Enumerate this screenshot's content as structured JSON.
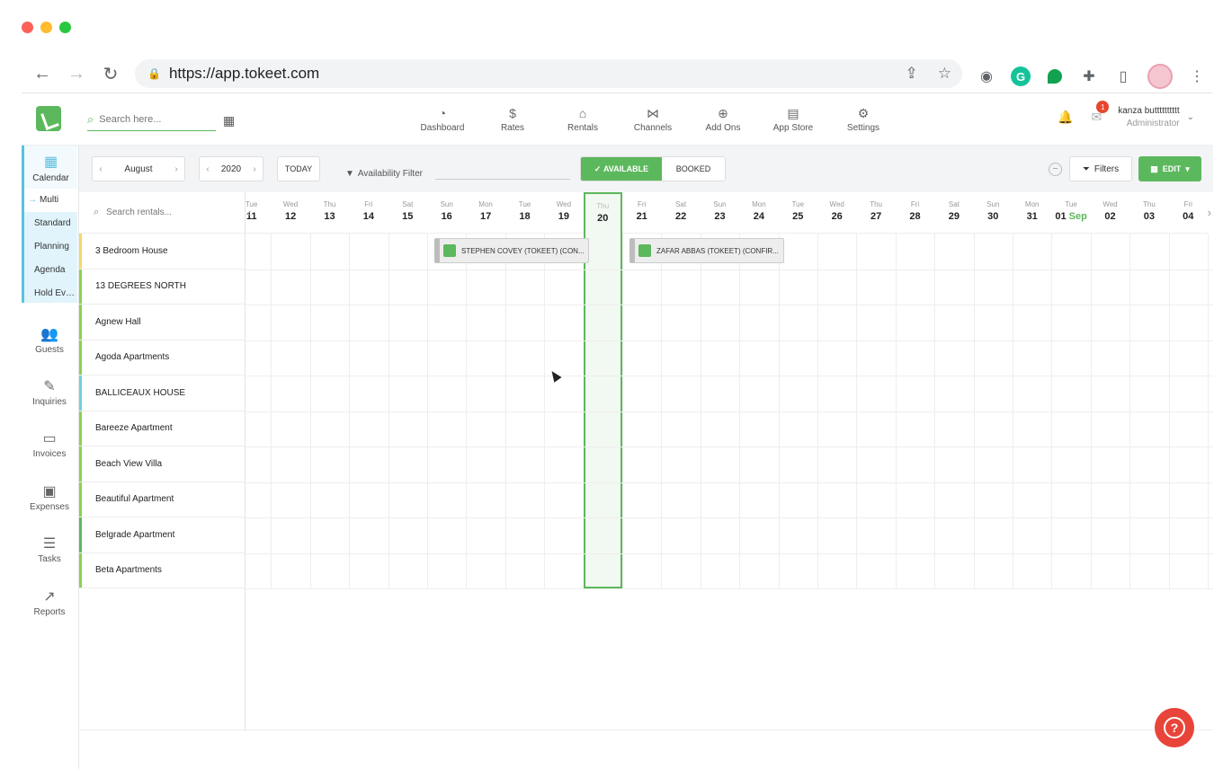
{
  "browser": {
    "url": "https://app.tokeet.com",
    "back_icon": "←",
    "forward_icon": "→",
    "reload_icon": "↻"
  },
  "header": {
    "search_placeholder": "Search here...",
    "nav": [
      {
        "label": "Dashboard",
        "icon": "◔"
      },
      {
        "label": "Rates",
        "icon": "$"
      },
      {
        "label": "Rentals",
        "icon": "⌂"
      },
      {
        "label": "Channels",
        "icon": "⋈"
      },
      {
        "label": "Add Ons",
        "icon": "⊕"
      },
      {
        "label": "App Store",
        "icon": "▤"
      },
      {
        "label": "Settings",
        "icon": "⚙"
      }
    ],
    "notification_count": "1",
    "user_name": "kanza butttttttttt",
    "user_role": "Administrator"
  },
  "sidebar": {
    "calendar_label": "Calendar",
    "submenu": [
      {
        "label": "Multi",
        "active": true
      },
      {
        "label": "Standard"
      },
      {
        "label": "Planning"
      },
      {
        "label": "Agenda"
      },
      {
        "label": "Hold Eve..."
      }
    ],
    "items": [
      {
        "label": "Guests",
        "icon": "👥"
      },
      {
        "label": "Inquiries",
        "icon": "✎"
      },
      {
        "label": "Invoices",
        "icon": "▭"
      },
      {
        "label": "Expenses",
        "icon": "▣"
      },
      {
        "label": "Tasks",
        "icon": "☰"
      },
      {
        "label": "Reports",
        "icon": "↗"
      }
    ]
  },
  "toolbar": {
    "month": "August",
    "year": "2020",
    "today_label": "TODAY",
    "availability_filter": "Availability Filter",
    "available_label": "AVAILABLE",
    "booked_label": "BOOKED",
    "filters_label": "Filters",
    "edit_label": "EDIT"
  },
  "rentals": {
    "search_placeholder": "Search rentals...",
    "list": [
      {
        "name": "3 Bedroom House",
        "color": "#f5d76e"
      },
      {
        "name": "13 DEGREES NORTH",
        "color": "#8bd150"
      },
      {
        "name": "Agnew Hall",
        "color": "#8bd150"
      },
      {
        "name": "Agoda Apartments",
        "color": "#8bd150"
      },
      {
        "name": "BALLICEAUX HOUSE",
        "color": "#6fd0e0"
      },
      {
        "name": "Bareeze Apartment",
        "color": "#8bd150"
      },
      {
        "name": "Beach View Villa",
        "color": "#8bd150"
      },
      {
        "name": "Beautiful Apartment",
        "color": "#8bd150"
      },
      {
        "name": "Belgrade Apartment",
        "color": "#5cb85c"
      },
      {
        "name": "Beta Apartments",
        "color": "#8bd150"
      }
    ]
  },
  "days": [
    {
      "dn": "Tue",
      "dd": "11"
    },
    {
      "dn": "Wed",
      "dd": "12"
    },
    {
      "dn": "Thu",
      "dd": "13"
    },
    {
      "dn": "Fri",
      "dd": "14"
    },
    {
      "dn": "Sat",
      "dd": "15"
    },
    {
      "dn": "Sun",
      "dd": "16"
    },
    {
      "dn": "Mon",
      "dd": "17"
    },
    {
      "dn": "Tue",
      "dd": "18"
    },
    {
      "dn": "Wed",
      "dd": "19"
    },
    {
      "dn": "Thu",
      "dd": "20",
      "today": true
    },
    {
      "dn": "Fri",
      "dd": "21"
    },
    {
      "dn": "Sat",
      "dd": "22"
    },
    {
      "dn": "Sun",
      "dd": "23"
    },
    {
      "dn": "Mon",
      "dd": "24"
    },
    {
      "dn": "Tue",
      "dd": "25"
    },
    {
      "dn": "Wed",
      "dd": "26"
    },
    {
      "dn": "Thu",
      "dd": "27"
    },
    {
      "dn": "Fri",
      "dd": "28"
    },
    {
      "dn": "Sat",
      "dd": "29"
    },
    {
      "dn": "Sun",
      "dd": "30"
    },
    {
      "dn": "Mon",
      "dd": "31"
    },
    {
      "dn": "Tue",
      "dd": "01",
      "month": "Sep"
    },
    {
      "dn": "Wed",
      "dd": "02"
    },
    {
      "dn": "Thu",
      "dd": "03"
    },
    {
      "dn": "Fri",
      "dd": "04"
    }
  ],
  "bookings": [
    {
      "label": "STEPHEN COVEY (TOKEET) (CON...",
      "rental": 0,
      "start_day": "16",
      "end_day": "19"
    },
    {
      "label": "ZAFAR ABBAS (TOKEET) (CONFIR...",
      "rental": 0,
      "start_day": "21",
      "end_day": "24"
    }
  ]
}
